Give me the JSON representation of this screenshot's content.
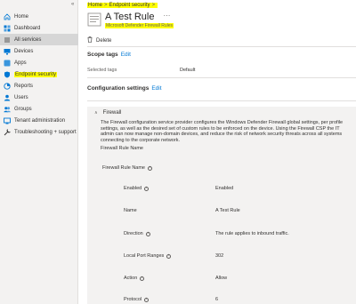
{
  "sidebar": {
    "collapse_icon": "«",
    "items": [
      {
        "label": "Home",
        "icon": "home-icon",
        "selected": false,
        "highlighted": false
      },
      {
        "label": "Dashboard",
        "icon": "dashboard-icon",
        "selected": false,
        "highlighted": false
      },
      {
        "label": "All services",
        "icon": "list-icon",
        "selected": true,
        "highlighted": false
      },
      {
        "label": "Devices",
        "icon": "devices-icon",
        "selected": false,
        "highlighted": false
      },
      {
        "label": "Apps",
        "icon": "apps-icon",
        "selected": false,
        "highlighted": false
      },
      {
        "label": "Endpoint security",
        "icon": "shield-icon",
        "selected": false,
        "highlighted": true
      },
      {
        "label": "Reports",
        "icon": "reports-icon",
        "selected": false,
        "highlighted": false
      },
      {
        "label": "Users",
        "icon": "user-icon",
        "selected": false,
        "highlighted": false
      },
      {
        "label": "Groups",
        "icon": "groups-icon",
        "selected": false,
        "highlighted": false
      },
      {
        "label": "Tenant administration",
        "icon": "tenant-icon",
        "selected": false,
        "highlighted": false
      },
      {
        "label": "Troubleshooting + support",
        "icon": "wrench-icon",
        "selected": false,
        "highlighted": false
      }
    ]
  },
  "breadcrumb": {
    "home": "Home",
    "separator": ">",
    "current": "Endpoint security",
    "trail_sep": ">"
  },
  "header": {
    "title": "A Test Rule",
    "more": "···",
    "subtitle": "Microsoft Defender Firewall Rules"
  },
  "toolbar": {
    "delete_label": "Delete"
  },
  "scope_tags": {
    "heading": "Scope tags",
    "edit": "Edit",
    "selected_label": "Selected tags",
    "selected_value": "Default"
  },
  "config": {
    "heading": "Configuration settings",
    "edit": "Edit"
  },
  "firewall": {
    "chevron": "∧",
    "title": "Firewall",
    "description": "The Firewall configuration service provider configures the Windows Defender Firewall global settings, per profile settings, as well as the desired set of custom rules to be enforced on the device. Using the Firewall CSP the IT admin can now manage non-domain devices, and reduce the risk of network security threats across all systems connecting to the corporate network.",
    "rule_name_label": "Firewall Rule Name",
    "rule_name_label2": "Firewall Rule Name",
    "info": "i",
    "rows": [
      {
        "label": "Enabled",
        "value": "Enabled"
      },
      {
        "label": "Name",
        "value": "A Test Rule"
      },
      {
        "label": "Direction",
        "value": "The rule applies to inbound traffic."
      },
      {
        "label": "Local Port Ranges",
        "value": "302"
      },
      {
        "label": "Action",
        "value": "Allow"
      },
      {
        "label": "Protocol",
        "value": "6"
      }
    ]
  },
  "colors": {
    "highlight": "#ffff00",
    "accent": "#0078d4",
    "sidebar_bg": "#f3f2f1"
  }
}
